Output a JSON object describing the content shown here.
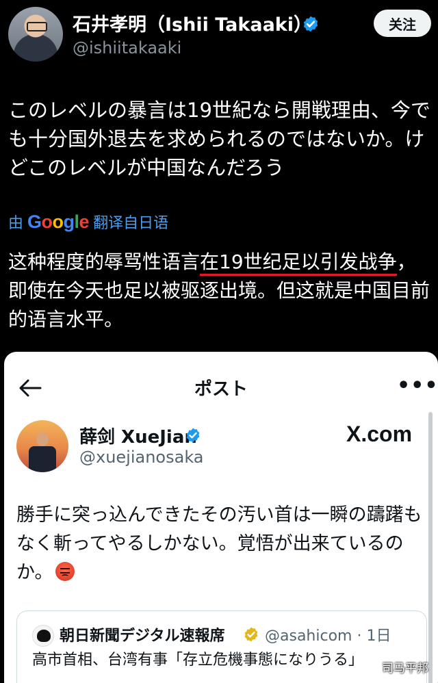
{
  "tweet": {
    "author": {
      "display_name": "石井孝明（Ishii Takaaki）",
      "handle": "@ishiitakaaki",
      "verified": true
    },
    "follow_label": "关注",
    "original_text": "このレベルの暴言は19世紀なら開戦理由、今でも十分国外退去を求められるのではないか。けどこのレベルが中国なんだろう",
    "translated_by": {
      "prefix": "由",
      "provider": "Google",
      "suffix": "翻译自日语"
    },
    "translated_text": {
      "before": "这种程度的辱骂性语言",
      "highlighted": "在19世纪足以引发战争",
      "after": "，即使在今天也足以被驱逐出境。但这就是中国目前的语言水平。"
    }
  },
  "embedded_post": {
    "header_title": "ポスト",
    "author": {
      "display_name": "薛剑 XueJian",
      "handle": "@xuejianosaka",
      "verified": true
    },
    "source_logo": "X.com",
    "text": "勝手に突っ込んできたその汚い首は一瞬の躊躇もなく斬ってやるしかない。覚悟が出来ているのか。",
    "emoji": "angry-face",
    "quote": {
      "author_name": "朝日新聞デジタル速報席",
      "handle_and_time": "@asahicom · 1日",
      "text": "高市首相、台湾有事「存立危機事態になりうる」"
    }
  },
  "watermark": "司马平邦",
  "colors": {
    "background": "#000000",
    "link_blue": "#4a9eed",
    "verified_blue": "#1d9bf0",
    "verified_gold": "#e2b719",
    "underline_red": "#e3182d"
  }
}
